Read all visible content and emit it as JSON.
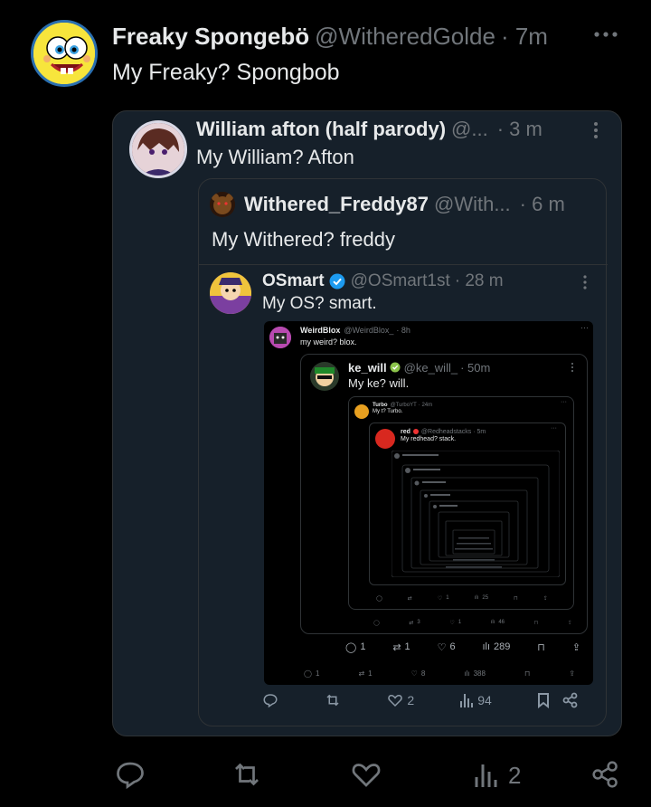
{
  "main": {
    "author_name": "Freaky Spongebö",
    "handle": "@WitheredGolde",
    "time": "· 7m",
    "text": "My Freaky? Spongbob",
    "actions": {
      "replies": "",
      "retweets": "",
      "likes": "",
      "views": "2"
    }
  },
  "q1": {
    "author_name": "William afton (half parody)",
    "handle": "@...",
    "time": "· 3 m",
    "text": "My William? Afton",
    "actions": {
      "likes": "2",
      "views": "94"
    }
  },
  "q2": {
    "author_name": "Withered_Freddy87",
    "handle": "@With...",
    "time": "· 6 m",
    "text": "My Withered? freddy"
  },
  "q3": {
    "author_name": "OSmart",
    "handle": "@OSmart1st",
    "time": "· 28 m",
    "text": "My OS? smart.",
    "actions": {
      "replies": "1",
      "retweets": "1",
      "likes": "8",
      "views": "388"
    }
  },
  "q4": {
    "author_name": "WeirdBlox",
    "handle": "@WeirdBlox_",
    "time": "· 8h",
    "text": "my weird? blox.",
    "actions": {
      "replies": "1",
      "retweets": "1",
      "likes": "6",
      "views": "289"
    }
  },
  "q5": {
    "author_name": "ke_will",
    "handle": "@ke_will_",
    "time": "· 50m",
    "text": "My ke? will.",
    "actions": {
      "replies": "",
      "retweets": "3",
      "likes": "1",
      "views": "46"
    }
  },
  "q6": {
    "author_name": "Turbo",
    "handle": "@TurboYT",
    "time": "· 24m",
    "text": "My t? Turbo.",
    "actions": {
      "likes": "1",
      "views": "25"
    }
  },
  "q7": {
    "author_name": "red",
    "handle": "@Redheadstacks",
    "time": "· 5m",
    "text": "My redhead? stack."
  },
  "colors": {
    "background": "#000000",
    "card": "#16202a",
    "verified": "#1d9bf0",
    "muted": "#71767b"
  }
}
